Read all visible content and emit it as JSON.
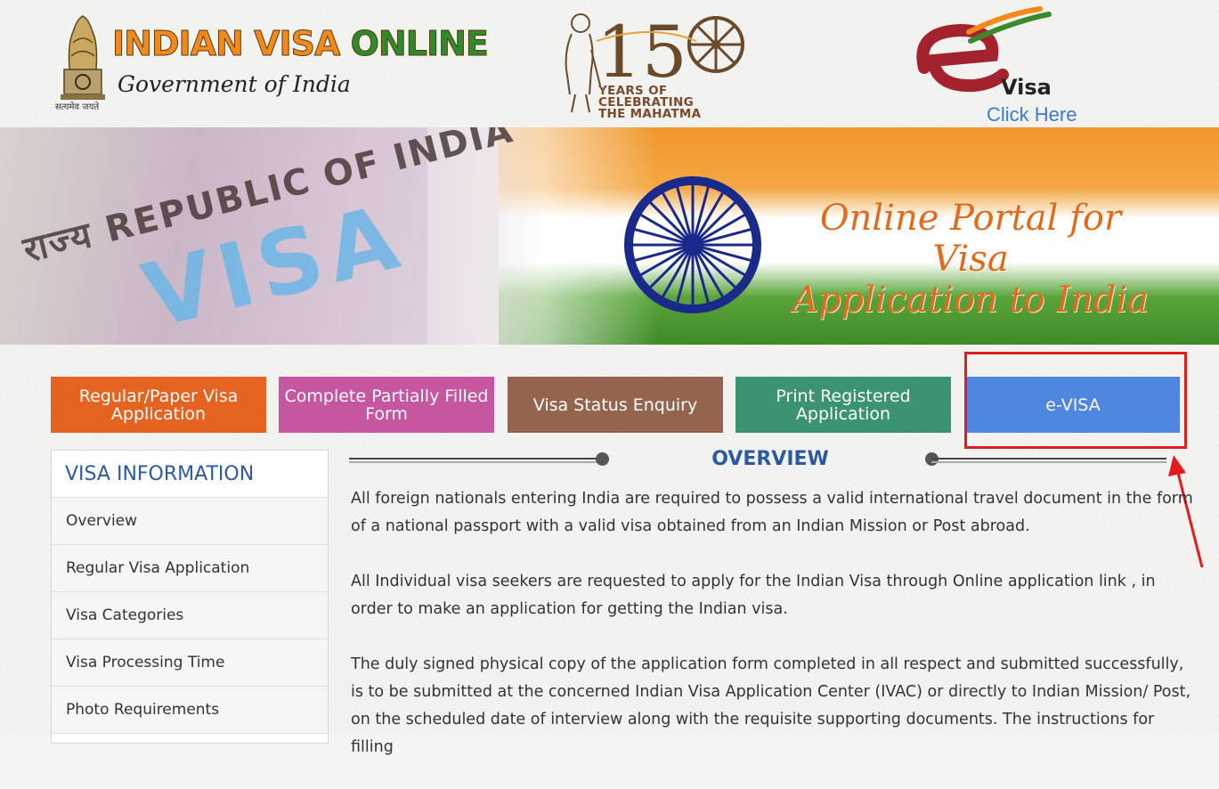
{
  "header": {
    "brand_part1": "INDIAN VISA",
    "brand_part2": "ONLINE",
    "brand_sub": "Government of India",
    "emblem_motto": "सत्यमेव जयते",
    "m150_caption_1": "YEARS OF",
    "m150_caption_2": "CELEBRATING",
    "m150_caption_3": "THE MAHATMA",
    "evisa_word": "Visa",
    "evisa_link": "Click Here"
  },
  "banner": {
    "stamp_text": "राज्य REPUBLIC OF INDIA",
    "visa_text": "VISA",
    "title_line1": "Online Portal for Visa",
    "title_line2": "Application to India"
  },
  "nav_buttons": [
    {
      "label": "Regular/Paper Visa Application",
      "color": "#e56320"
    },
    {
      "label": "Complete Partially Filled Form",
      "color": "#c656a0"
    },
    {
      "label": "Visa Status Enquiry",
      "color": "#94644e"
    },
    {
      "label": "Print Registered Application",
      "color": "#3b9370"
    },
    {
      "label": "e-VISA",
      "color": "#4f86e0"
    }
  ],
  "sidebar": {
    "heading": "VISA INFORMATION",
    "items": [
      {
        "label": "Overview"
      },
      {
        "label": "Regular Visa Application"
      },
      {
        "label": "Visa Categories"
      },
      {
        "label": "Visa Processing Time"
      },
      {
        "label": "Photo Requirements"
      }
    ]
  },
  "overview": {
    "title": "OVERVIEW",
    "paragraphs": [
      "All foreign nationals entering India are required to possess a valid international travel document in the form of a national passport with a valid visa obtained from an Indian Mission or Post abroad.",
      "All Individual visa seekers are requested to apply for the Indian Visa through Online application link , in order to make an application for getting the Indian visa.",
      "The duly signed physical copy of the application form completed in all respect and submitted successfully, is to be submitted at the concerned Indian Visa Application Center (IVAC) or directly to Indian Mission/ Post, on the scheduled date of interview along with the requisite supporting documents. The instructions for filling"
    ]
  },
  "colors": {
    "accent_blue": "#2c5aa0",
    "highlight_red": "#e21c1c",
    "saffron": "#f0962a",
    "green": "#3f8a28"
  }
}
